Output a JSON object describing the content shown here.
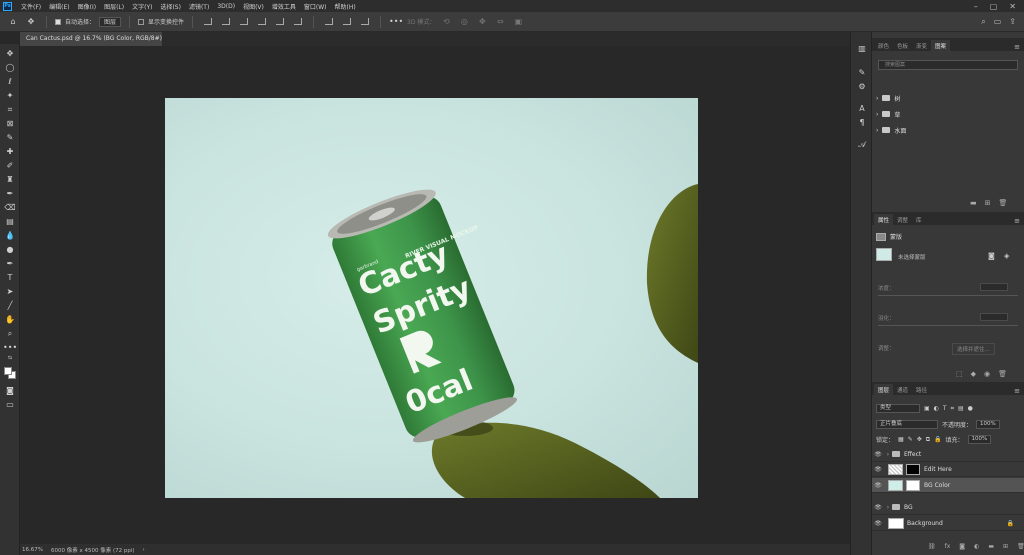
{
  "menubar": {
    "logo": "Ps",
    "items": [
      "文件(F)",
      "编辑(E)",
      "图像(I)",
      "图层(L)",
      "文字(Y)",
      "选择(S)",
      "滤镜(T)",
      "3D(D)",
      "视图(V)",
      "增效工具",
      "窗口(W)",
      "帮助(H)"
    ]
  },
  "options": {
    "auto_select_label": "自动选择：",
    "auto_select_value": "图层",
    "transform_label": "显示变换控件",
    "mode_3d_label": "3D 模式："
  },
  "document_tab": {
    "title": "Can Cactus.psd @ 16.7% (BG Color, RGB/8#)",
    "close": "×"
  },
  "can": {
    "brand_small": "garbrand",
    "line1": "Cacty",
    "line2": "Sprity",
    "line3": "0cal",
    "side_text": "RIVER VISUAL MOCKUP"
  },
  "statusbar": {
    "zoom": "16.67%",
    "doc_size": "6000 像素 x 4500 像素 (72 ppi)",
    "arrow": "›"
  },
  "library_panel": {
    "tabs": [
      "颜色",
      "色板",
      "渐变",
      "图案"
    ],
    "active_tab": "图案",
    "search_placeholder": "搜索图案",
    "folders": [
      "树",
      "草",
      "水面"
    ]
  },
  "properties_panel": {
    "tabs": [
      "属性",
      "调整",
      "库"
    ],
    "active_tab": "属性",
    "mask_label": "蒙版",
    "no_selection": "未选择蒙版",
    "density_label": "浓度：",
    "feather_label": "羽化：",
    "refine_label": "调整：",
    "select_mask_button": "选择并遮住..."
  },
  "layers_panel": {
    "tabs": [
      "图层",
      "通道",
      "路径"
    ],
    "active_tab": "图层",
    "filter_kind": "类型",
    "blend_mode": "正片叠底",
    "opacity_label": "不透明度：",
    "opacity_value": "100%",
    "lock_label": "锁定：",
    "fill_label": "填充：",
    "fill_value": "100%",
    "layers": [
      {
        "name": "Effect",
        "type": "group"
      },
      {
        "name": "Edit Here",
        "type": "smart"
      },
      {
        "name": "BG Color",
        "type": "fill",
        "selected": true
      },
      {
        "name": "BG",
        "type": "group"
      },
      {
        "name": "Background",
        "type": "background"
      }
    ]
  },
  "colors": {
    "can_green": "#3f9a49",
    "bg_mint": "#cfe8e4",
    "cactus": "#5c6a22",
    "accent_blue": "#31a8ff"
  }
}
